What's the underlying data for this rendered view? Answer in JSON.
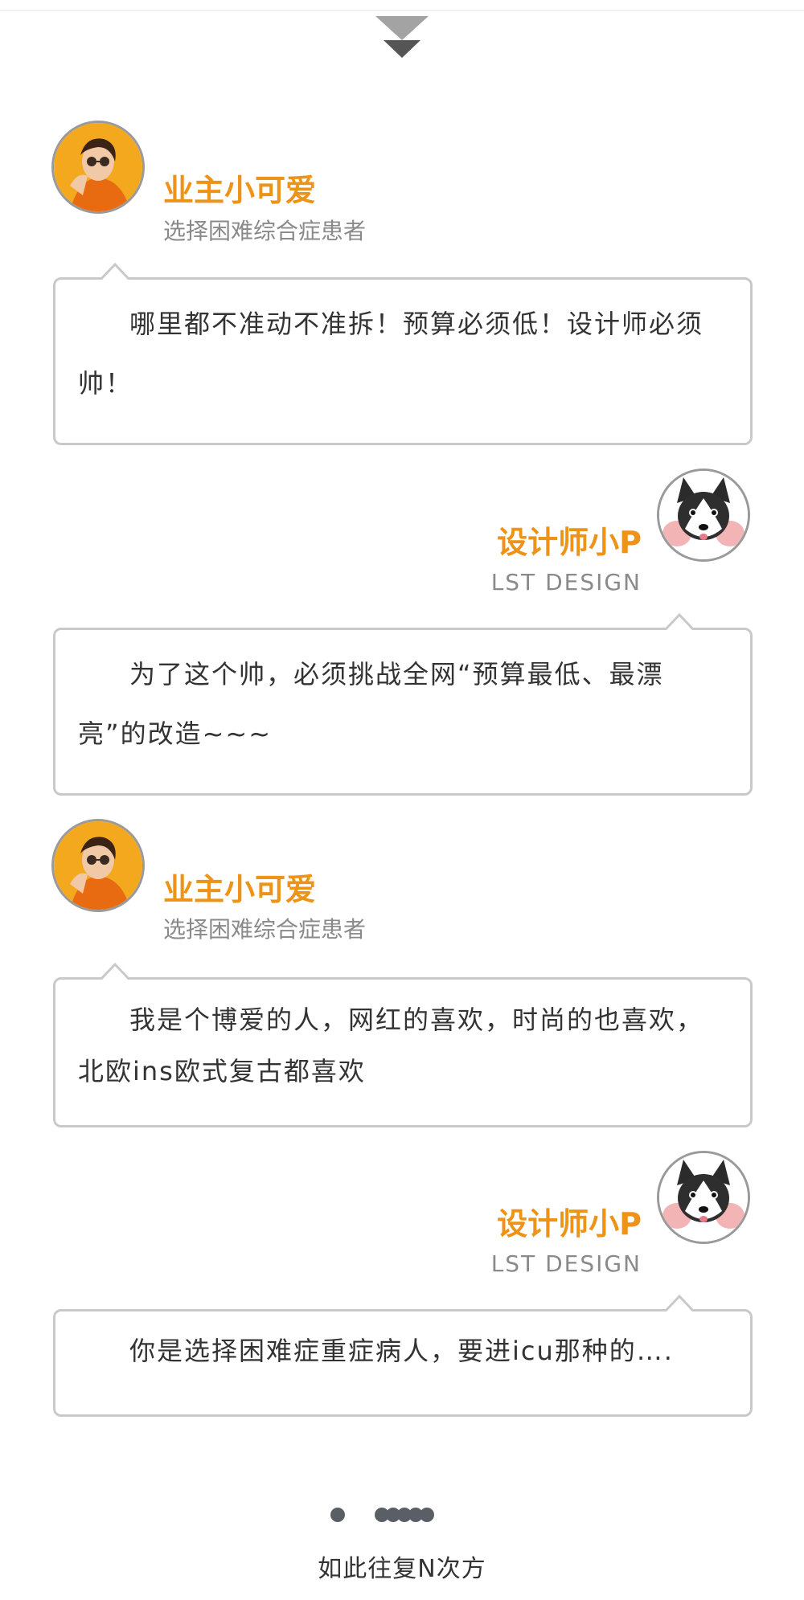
{
  "conversation": [
    {
      "speaker": "owner",
      "name": "业主小可爱",
      "subtitle": "选择困难综合症患者",
      "avatar": "woman-sunglasses-avatar",
      "message": "哪里都不准动不准拆！预算必须低！设计师必须帅！"
    },
    {
      "speaker": "designer",
      "name": "设计师小P",
      "subtitle": "LST   DESIGN",
      "avatar": "husky-dog-avatar",
      "message": "为了这个帅，必须挑战全网“预算最低、最漂亮”的改造~~~"
    },
    {
      "speaker": "owner",
      "name": "业主小可爱",
      "subtitle": "选择困难综合症患者",
      "avatar": "woman-sunglasses-avatar",
      "message": "我是个博爱的人，网红的喜欢，时尚的也喜欢，北欧ins欧式复古都喜欢"
    },
    {
      "speaker": "designer",
      "name": "设计师小P",
      "subtitle": "LST   DESIGN",
      "avatar": "husky-dog-avatar",
      "message": "你是选择困难症重症病人，要进icu那种的…."
    }
  ],
  "footer": {
    "text": "如此往复N次方"
  },
  "colors": {
    "name_accent": "#ed9317",
    "subtitle": "#8a8a8a",
    "bubble_border": "#c9c9c9",
    "dots": "#5a5f66",
    "arrows": "#888888"
  }
}
